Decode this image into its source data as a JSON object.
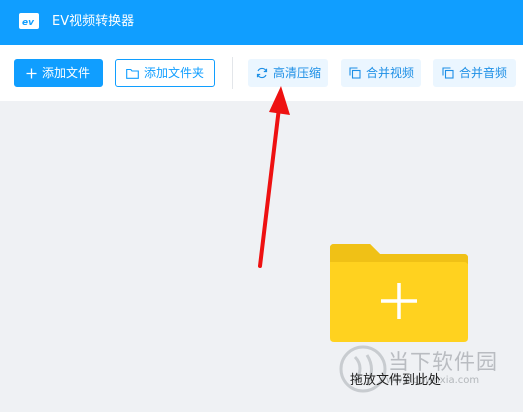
{
  "window": {
    "title": "EV视频转换器",
    "logo_icon": "ev-logo-icon"
  },
  "toolbar": {
    "add_file_label": "添加文件",
    "add_folder_label": "添加文件夹",
    "hd_compress_label": "高清压缩",
    "merge_video_label": "合并视频",
    "merge_audio_label": "合并音频"
  },
  "content": {
    "drop_hint": "拖放文件到此处"
  },
  "watermark": {
    "text_cn": "当下软件园",
    "text_en": "www.downxia.com"
  },
  "colors": {
    "accent": "#109eff",
    "background": "#eff1f4",
    "folder": "#ffd21f",
    "annotation_arrow": "#ee1111"
  }
}
